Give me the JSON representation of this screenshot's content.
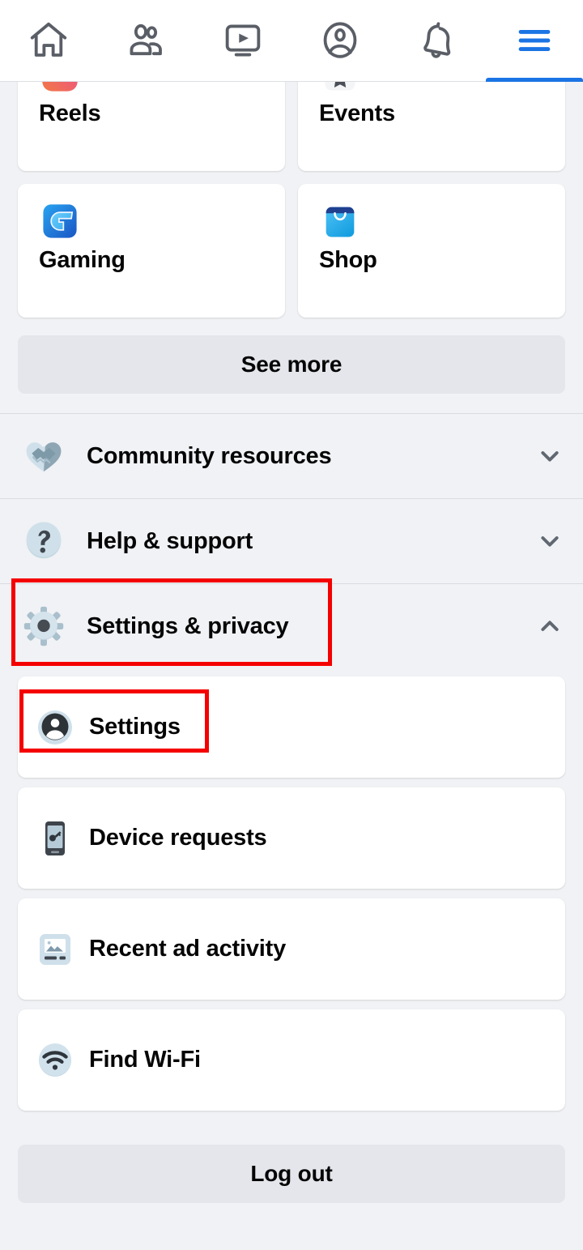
{
  "topnav": {
    "items": [
      {
        "name": "home",
        "icon": "home-icon",
        "active": false
      },
      {
        "name": "friends",
        "icon": "friends-icon",
        "active": false
      },
      {
        "name": "watch",
        "icon": "video-play-icon",
        "active": false
      },
      {
        "name": "profile",
        "icon": "profile-circle-icon",
        "active": false
      },
      {
        "name": "notifications",
        "icon": "bell-icon",
        "active": false
      },
      {
        "name": "menu",
        "icon": "hamburger-menu-icon",
        "active": true
      }
    ],
    "active_color": "#1b74e4"
  },
  "shortcuts": {
    "cards": [
      {
        "label": "Reels",
        "icon": "reels-icon"
      },
      {
        "label": "Events",
        "icon": "events-calendar-icon"
      },
      {
        "label": "Gaming",
        "icon": "gaming-controller-icon"
      },
      {
        "label": "Shop",
        "icon": "shopping-bag-icon"
      }
    ],
    "see_more_label": "See more"
  },
  "accordions": [
    {
      "label": "Community resources",
      "icon": "handshake-heart-icon",
      "state": "collapsed",
      "chevron": "chevron-down-icon",
      "highlighted": false
    },
    {
      "label": "Help & support",
      "icon": "question-mark-icon",
      "state": "collapsed",
      "chevron": "chevron-down-icon",
      "highlighted": false
    },
    {
      "label": "Settings & privacy",
      "icon": "gear-icon",
      "state": "expanded",
      "chevron": "chevron-up-icon",
      "highlighted": true
    }
  ],
  "settings_submenu": [
    {
      "label": "Settings",
      "icon": "account-avatar-icon",
      "highlighted": true
    },
    {
      "label": "Device requests",
      "icon": "phone-key-icon",
      "highlighted": false
    },
    {
      "label": "Recent ad activity",
      "icon": "ad-image-icon",
      "highlighted": false
    },
    {
      "label": "Find Wi-Fi",
      "icon": "wifi-icon",
      "highlighted": false
    }
  ],
  "footer": {
    "logout_label": "Log out"
  },
  "annotations": {
    "highlight_color": "#f50000",
    "boxes": [
      {
        "target": "Settings & privacy"
      },
      {
        "target": "Settings"
      }
    ]
  }
}
